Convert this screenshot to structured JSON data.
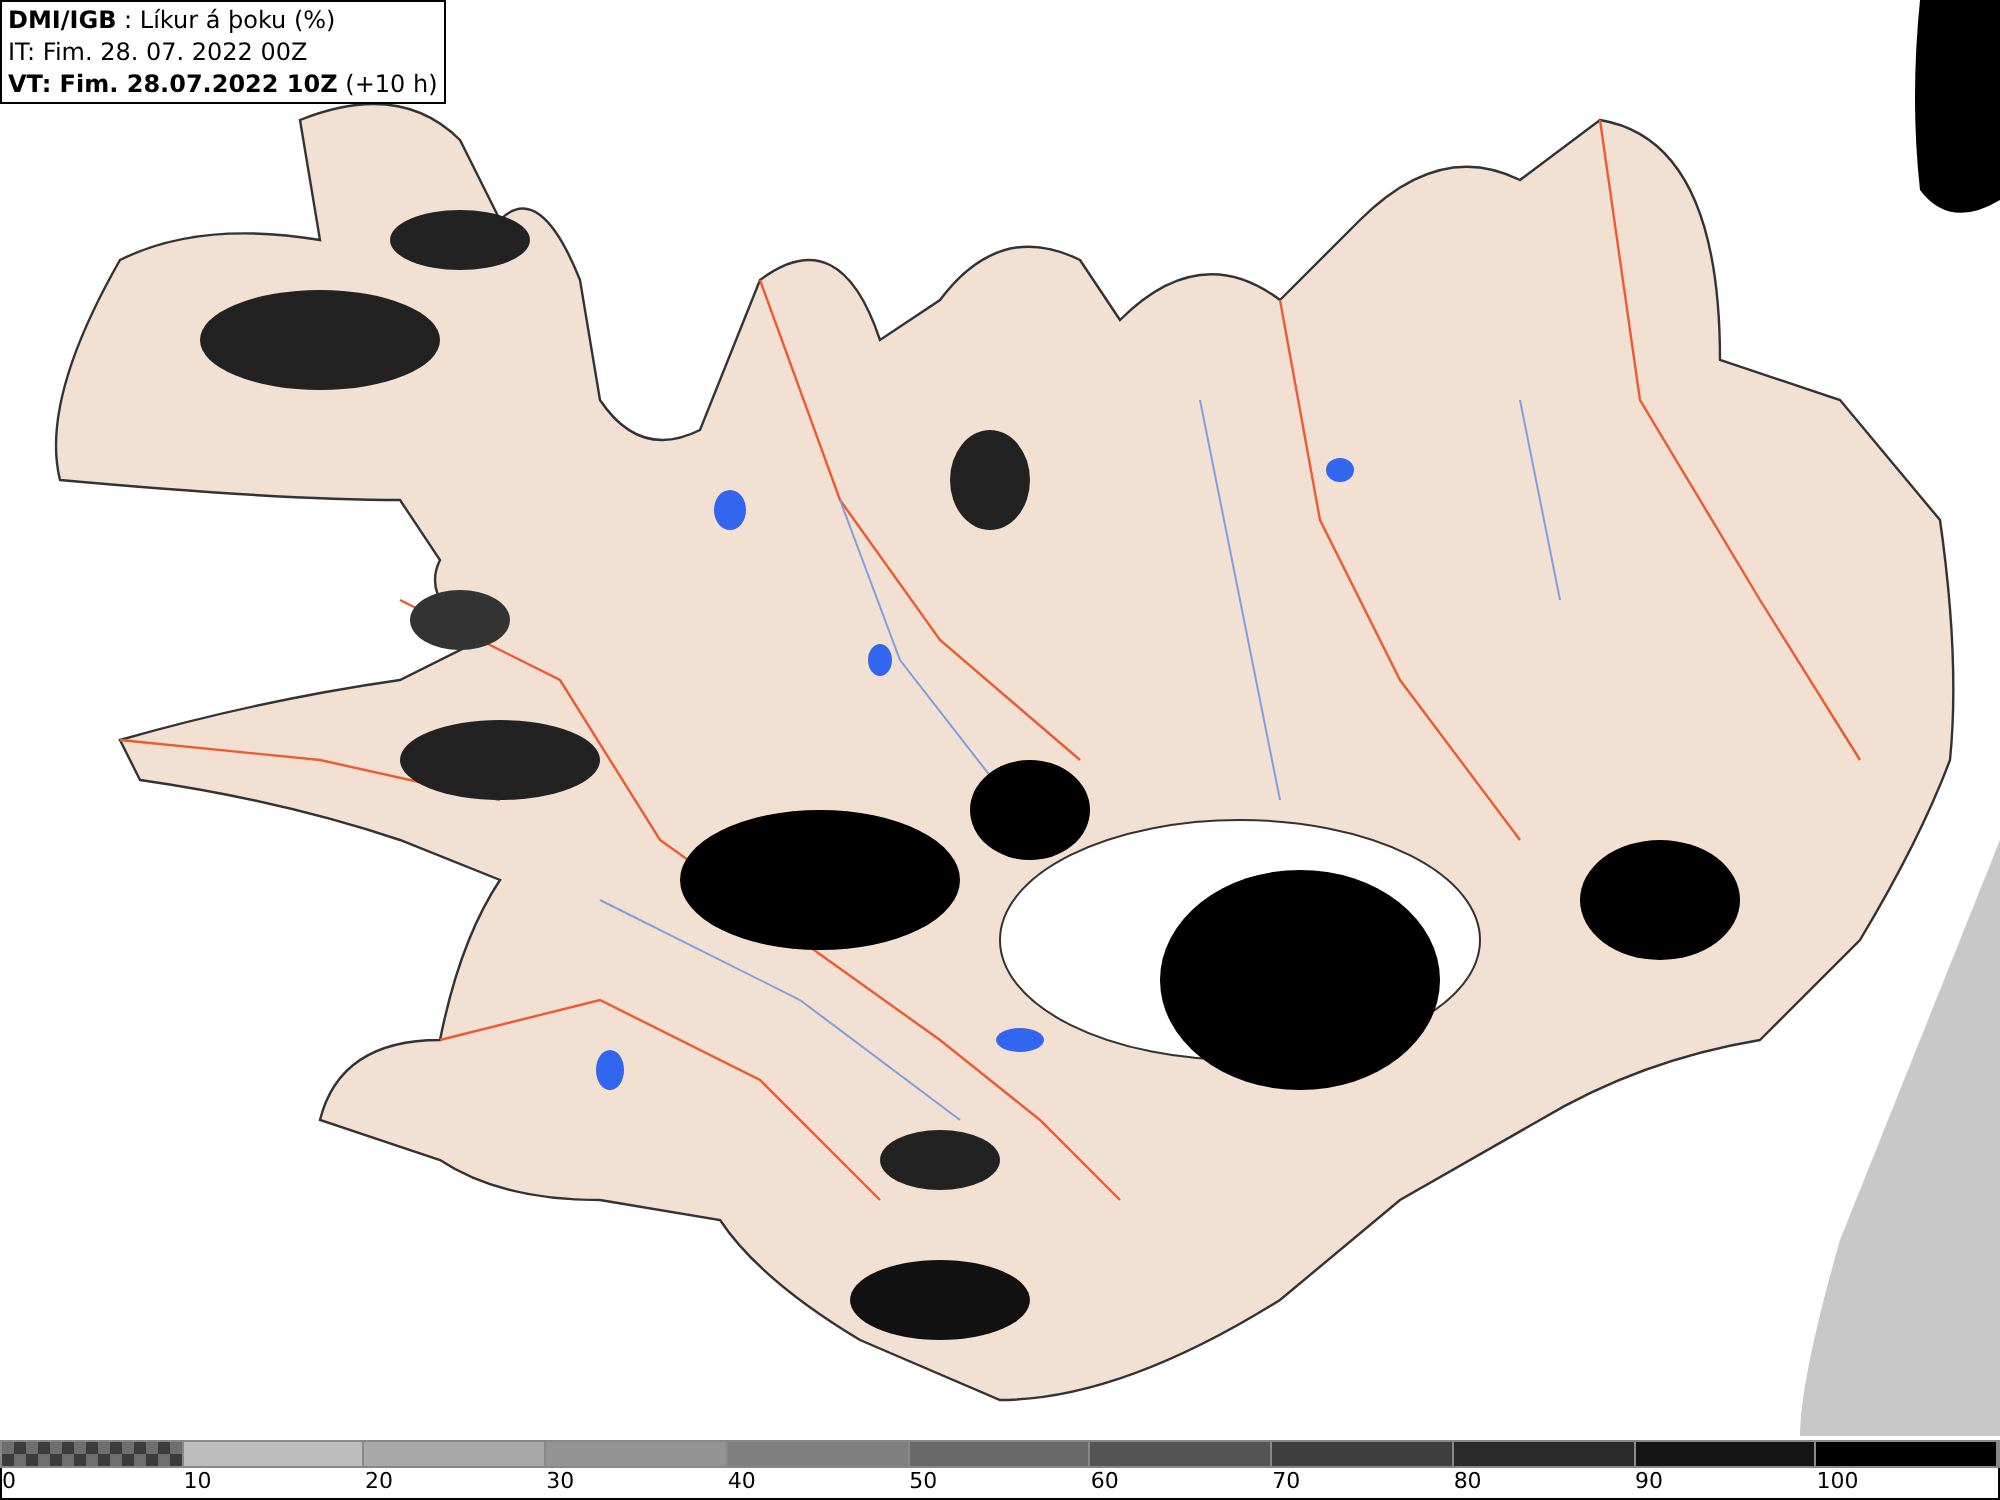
{
  "title_box": {
    "lines": [
      "**DMI/IGB** : Líkur á þoku (%)",
      "IT: Fim. 28. 07. 2022 00Z",
      "**VT: Fim. 28.07.2022 10Z** (+10 h)"
    ]
  },
  "legend": {
    "bins": [
      {
        "kind": "checker",
        "color": "#6e6e6e"
      },
      {
        "kind": "solid",
        "color": "#bdbdbd"
      },
      {
        "kind": "solid",
        "color": "#a8a8a8"
      },
      {
        "kind": "solid",
        "color": "#939393"
      },
      {
        "kind": "solid",
        "color": "#7e7e7e"
      },
      {
        "kind": "solid",
        "color": "#696969"
      },
      {
        "kind": "solid",
        "color": "#545454"
      },
      {
        "kind": "solid",
        "color": "#3e3e3e"
      },
      {
        "kind": "solid",
        "color": "#2a2a2a"
      },
      {
        "kind": "solid",
        "color": "#141414"
      },
      {
        "kind": "solid",
        "color": "#000000"
      }
    ],
    "labels": [
      "0",
      "10",
      "20",
      "30",
      "40",
      "50",
      "60",
      "70",
      "80",
      "90",
      "100"
    ]
  }
}
